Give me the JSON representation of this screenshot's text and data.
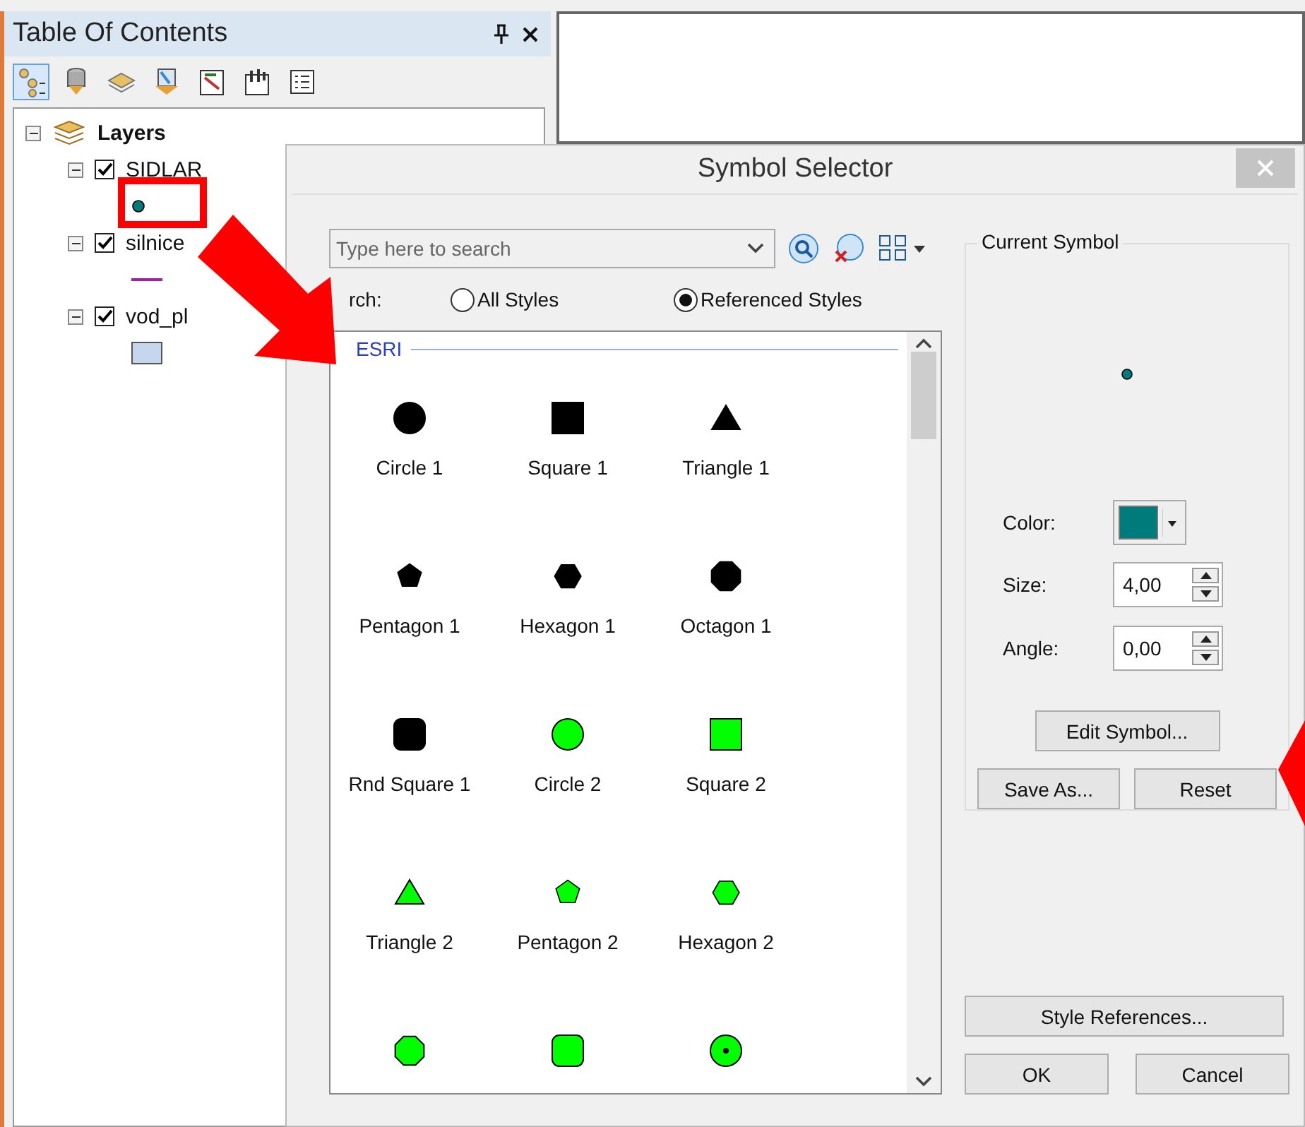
{
  "toc": {
    "title": "Table Of Contents",
    "root": {
      "label": "Layers",
      "expanded": true
    },
    "layers": [
      {
        "name": "SIDLAR",
        "checked": true,
        "expanded": true,
        "kind": "point",
        "color": "#007b7b"
      },
      {
        "name": "silnice",
        "checked": true,
        "expanded": true,
        "kind": "line",
        "color": "#a020a0"
      },
      {
        "name": "vod_pl",
        "checked": true,
        "expanded": true,
        "kind": "polygon",
        "color": "#c6d6ee"
      }
    ]
  },
  "dialog": {
    "title": "Symbol Selector",
    "search": {
      "placeholder": "Type here to search"
    },
    "search_label": "rch:",
    "scopes": [
      {
        "label": "All Styles",
        "selected": false
      },
      {
        "label": "Referenced Styles",
        "selected": true
      }
    ],
    "group": "ESRI",
    "symbols": [
      {
        "label": "Circle 1",
        "kind": "circle",
        "color": "#000000"
      },
      {
        "label": "Square 1",
        "kind": "square",
        "color": "#000000"
      },
      {
        "label": "Triangle 1",
        "kind": "triangle",
        "color": "#000000"
      },
      {
        "label": "Pentagon 1",
        "kind": "pentagon",
        "color": "#000000"
      },
      {
        "label": "Hexagon 1",
        "kind": "hexagon",
        "color": "#000000"
      },
      {
        "label": "Octagon 1",
        "kind": "octagon",
        "color": "#000000"
      },
      {
        "label": "Rnd Square 1",
        "kind": "rndsquare",
        "color": "#000000"
      },
      {
        "label": "Circle 2",
        "kind": "circle",
        "color": "#00ff00"
      },
      {
        "label": "Square 2",
        "kind": "square",
        "color": "#00ff00"
      },
      {
        "label": "Triangle 2",
        "kind": "triangle",
        "color": "#00ff00"
      },
      {
        "label": "Pentagon 2",
        "kind": "pentagon",
        "color": "#00ff00"
      },
      {
        "label": "Hexagon 2",
        "kind": "hexagon",
        "color": "#00ff00"
      },
      {
        "kind": "octagon",
        "color": "#00ff00"
      },
      {
        "kind": "rndsquare",
        "color": "#00ff00"
      },
      {
        "kind": "circledot",
        "color": "#00ff00"
      }
    ],
    "current": {
      "title": "Current Symbol",
      "color": "#007b7b",
      "color_label": "Color:",
      "size_label": "Size:",
      "size": "4,00",
      "angle_label": "Angle:",
      "angle": "0,00"
    },
    "buttons": {
      "edit": "Edit Symbol...",
      "save": "Save As...",
      "reset": "Reset",
      "refs": "Style References...",
      "ok": "OK",
      "cancel": "Cancel"
    }
  }
}
